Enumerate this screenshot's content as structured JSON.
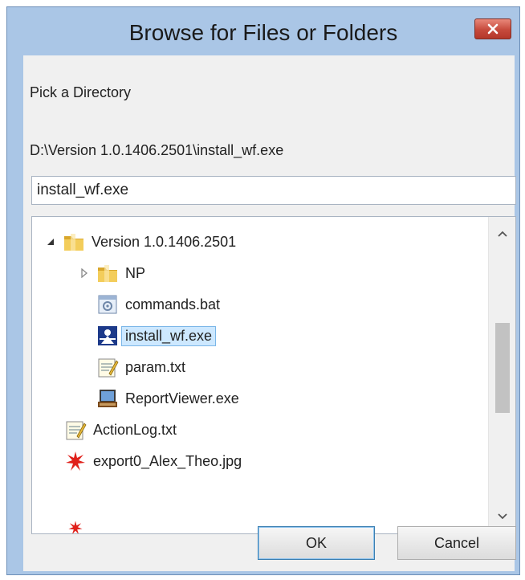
{
  "dialog": {
    "title": "Browse for Files or Folders",
    "prompt": "Pick a Directory",
    "current_path": "D:\\Version 1.0.1406.2501\\install_wf.exe",
    "name_value": "install_wf.exe"
  },
  "tree": {
    "items": [
      {
        "label": "Version 1.0.1406.2501",
        "icon": "folder-icon",
        "state": "expanded"
      },
      {
        "label": "NP",
        "icon": "folder-icon",
        "state": "collapsed"
      },
      {
        "label": "commands.bat",
        "icon": "batch-file-icon"
      },
      {
        "label": "install_wf.exe",
        "icon": "executable-icon",
        "selected": true
      },
      {
        "label": "param.txt",
        "icon": "text-file-icon"
      },
      {
        "label": "ReportViewer.exe",
        "icon": "executable-icon"
      },
      {
        "label": "ActionLog.txt",
        "icon": "text-file-icon"
      },
      {
        "label": "export0_Alex_Theo.jpg",
        "icon": "image-file-icon"
      }
    ]
  },
  "buttons": {
    "ok_label": "OK",
    "cancel_label": "Cancel"
  },
  "colors": {
    "frame": "#aac6e6",
    "close": "#c64a3c",
    "selection": "#cde8ff",
    "folder": "#e8b93a"
  }
}
